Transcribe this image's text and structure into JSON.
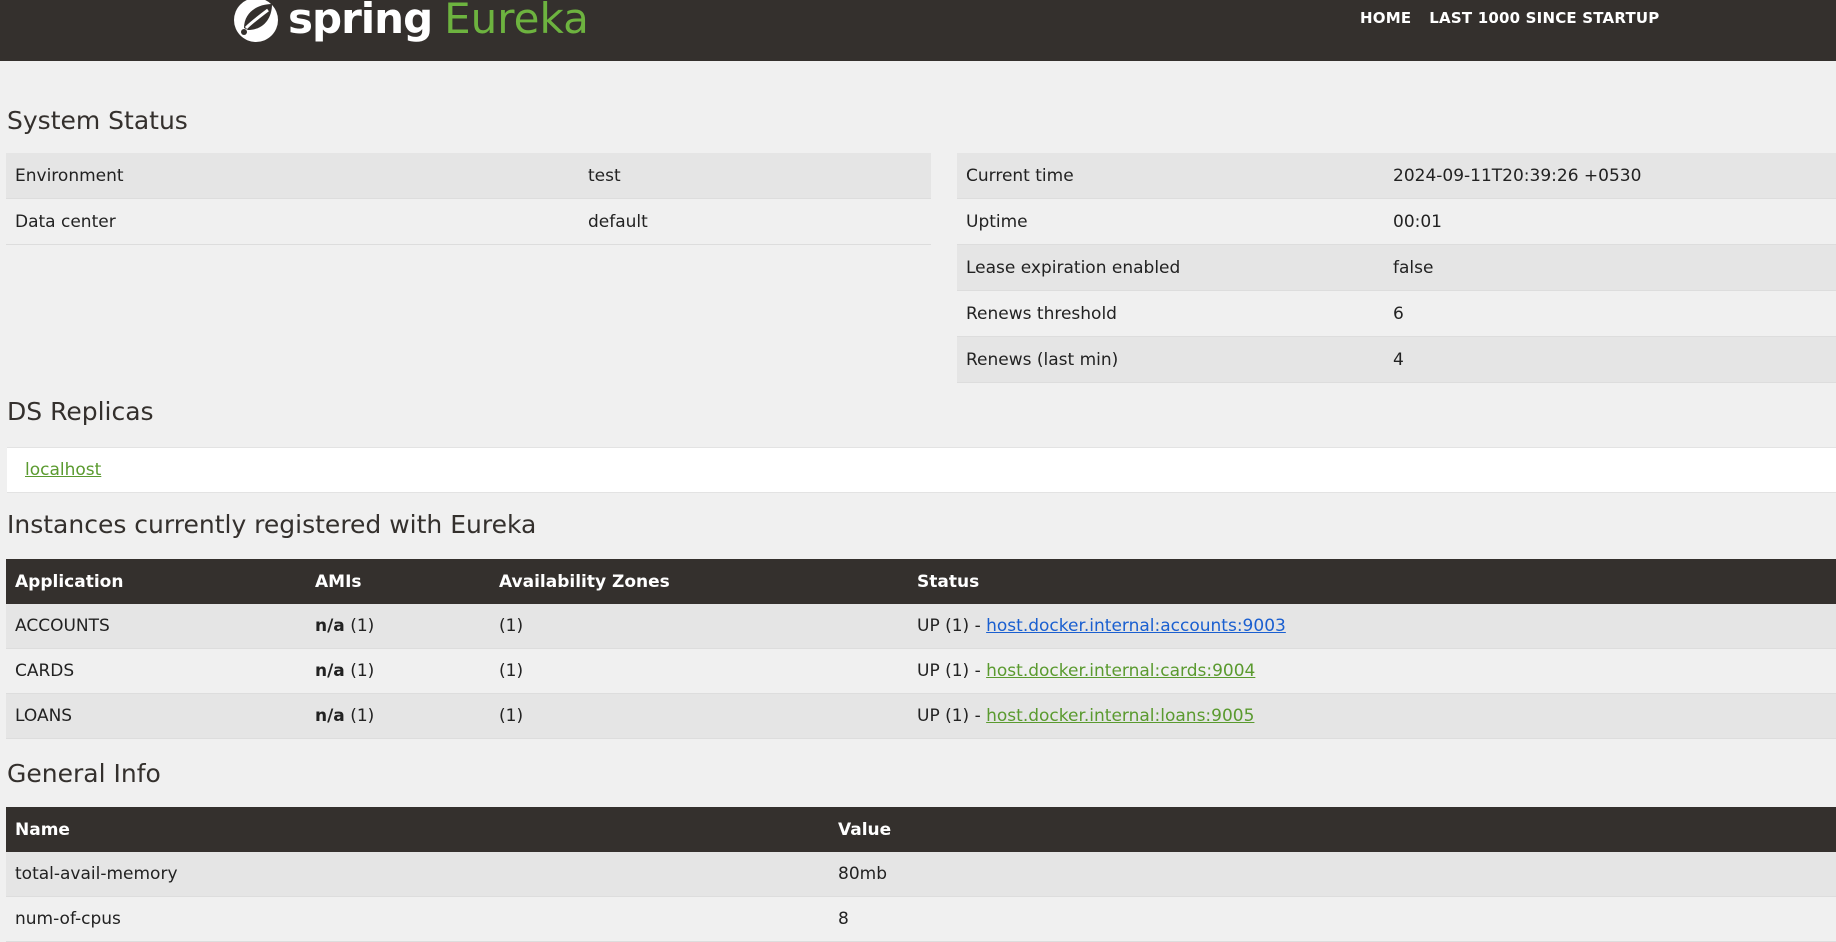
{
  "brand": {
    "spring": "spring",
    "eureka": "Eureka",
    "colors": {
      "header": "#34302d",
      "accent": "#6db33f"
    },
    "icon": "spring-leaf-icon"
  },
  "nav": {
    "home": "HOME",
    "last1000": "LAST 1000 SINCE STARTUP"
  },
  "system_status": {
    "title": "System Status",
    "left": [
      {
        "key": "Environment",
        "value": "test"
      },
      {
        "key": "Data center",
        "value": "default"
      }
    ],
    "right": [
      {
        "key": "Current time",
        "value": "2024-09-11T20:39:26 +0530"
      },
      {
        "key": "Uptime",
        "value": "00:01"
      },
      {
        "key": "Lease expiration enabled",
        "value": "false"
      },
      {
        "key": "Renews threshold",
        "value": "6"
      },
      {
        "key": "Renews (last min)",
        "value": "4"
      }
    ]
  },
  "ds_replicas": {
    "title": "DS Replicas",
    "items": [
      "localhost"
    ]
  },
  "instances": {
    "title": "Instances currently registered with Eureka",
    "headers": [
      "Application",
      "AMIs",
      "Availability Zones",
      "Status"
    ],
    "rows": [
      {
        "app": "ACCOUNTS",
        "ami": "n/a",
        "ami_count": "(1)",
        "zones": "(1)",
        "status": "UP (1) - ",
        "link": "host.docker.internal:accounts:9003"
      },
      {
        "app": "CARDS",
        "ami": "n/a",
        "ami_count": "(1)",
        "zones": "(1)",
        "status": "UP (1) - ",
        "link": "host.docker.internal:cards:9004"
      },
      {
        "app": "LOANS",
        "ami": "n/a",
        "ami_count": "(1)",
        "zones": "(1)",
        "status": "UP (1) - ",
        "link": "host.docker.internal:loans:9005"
      }
    ]
  },
  "general_info": {
    "title": "General Info",
    "headers": [
      "Name",
      "Value"
    ],
    "rows": [
      {
        "name": "total-avail-memory",
        "value": "80mb"
      },
      {
        "name": "num-of-cpus",
        "value": "8"
      }
    ]
  }
}
